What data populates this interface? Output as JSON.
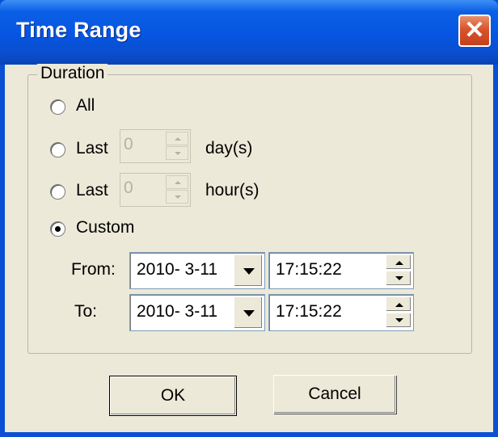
{
  "window": {
    "title": "Time Range"
  },
  "icons": {
    "close": "close-icon",
    "dropdown": "chevron-down-icon",
    "spin_up": "arrow-up-icon",
    "spin_down": "arrow-down-icon"
  },
  "group": {
    "label": "Duration"
  },
  "options": {
    "all": {
      "label": "All",
      "selected": false
    },
    "last_days": {
      "label": "Last",
      "value": "0",
      "unit": "day(s)",
      "selected": false
    },
    "last_hours": {
      "label": "Last",
      "value": "0",
      "unit": "hour(s)",
      "selected": false
    },
    "custom": {
      "label": "Custom",
      "selected": true
    }
  },
  "from": {
    "label": "From:",
    "date": "2010- 3-11",
    "time": "17:15:22"
  },
  "to": {
    "label": "To:",
    "date": "2010- 3-11",
    "time": "17:15:22"
  },
  "buttons": {
    "ok": "OK",
    "cancel": "Cancel"
  }
}
